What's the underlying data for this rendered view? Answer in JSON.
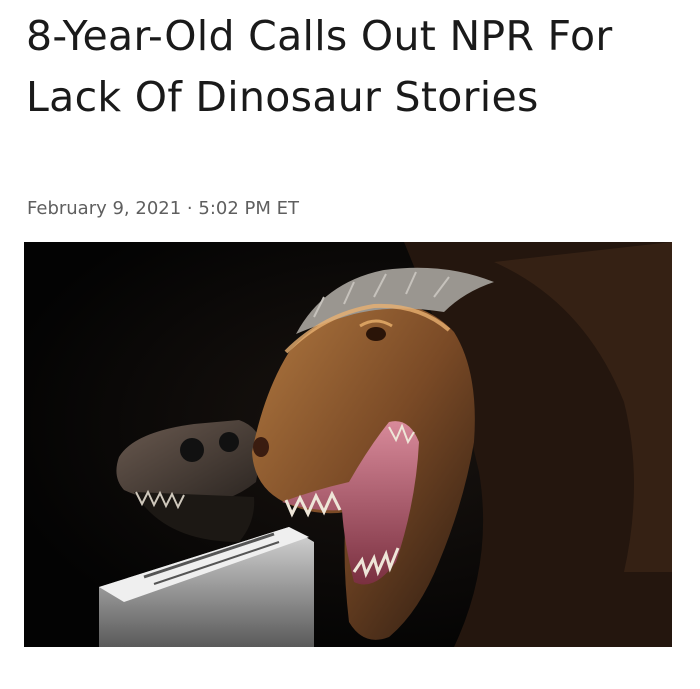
{
  "article": {
    "headline": "8-Year-Old Calls Out NPR For Lack Of Dinosaur Stories",
    "date": "February 9, 2021",
    "separator": "·",
    "time": "5:02 PM ET"
  },
  "image": {
    "subject": "t-rex-head-photo"
  },
  "colors": {
    "headline": "#1a1a1a",
    "dateline": "#5f5f5f",
    "photo_background": "#050505",
    "dinosaur_skin": "#8a5a30",
    "mouth": "#c87a8a"
  }
}
